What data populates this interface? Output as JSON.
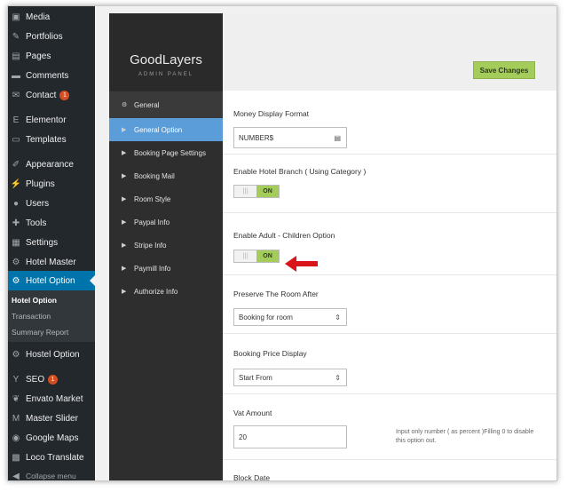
{
  "wp_sidebar": {
    "items": [
      {
        "label": "Media",
        "icon": "media-icon"
      },
      {
        "label": "Portfolios",
        "icon": "pin-icon"
      },
      {
        "label": "Pages",
        "icon": "page-icon"
      },
      {
        "label": "Comments",
        "icon": "comment-icon"
      },
      {
        "label": "Contact",
        "icon": "mail-icon",
        "badge": "1"
      },
      {
        "label": "Elementor",
        "icon": "elementor-icon"
      },
      {
        "label": "Templates",
        "icon": "folder-icon"
      },
      {
        "label": "Appearance",
        "icon": "brush-icon"
      },
      {
        "label": "Plugins",
        "icon": "plug-icon"
      },
      {
        "label": "Users",
        "icon": "user-icon"
      },
      {
        "label": "Tools",
        "icon": "wrench-icon"
      },
      {
        "label": "Settings",
        "icon": "settings-icon"
      },
      {
        "label": "Hotel Master",
        "icon": "gear-icon"
      },
      {
        "label": "Hotel Option",
        "icon": "gear-icon"
      },
      {
        "label": "Hostel Option",
        "icon": "gear-icon"
      },
      {
        "label": "SEO",
        "icon": "yoast-icon",
        "badge": "1"
      },
      {
        "label": "Envato Market",
        "icon": "envato-icon"
      },
      {
        "label": "Master Slider",
        "icon": "slider-icon"
      },
      {
        "label": "Google Maps",
        "icon": "globe-icon"
      },
      {
        "label": "Loco Translate",
        "icon": "loco-icon"
      },
      {
        "label": "Collapse menu",
        "icon": "collapse-icon"
      }
    ],
    "submenu": [
      "Hotel Option",
      "Transaction",
      "Summary Report"
    ]
  },
  "panel": {
    "brand": "GoodLayers",
    "subtitle": "ADMIN PANEL",
    "save_label": "Save Changes",
    "menu": [
      {
        "label": "General",
        "icon": "gear-icon"
      },
      {
        "label": "General Option",
        "icon": "chevron-right-icon"
      },
      {
        "label": "Booking Page Settings",
        "icon": "chevron-right-icon"
      },
      {
        "label": "Booking Mail",
        "icon": "chevron-right-icon"
      },
      {
        "label": "Room Style",
        "icon": "chevron-right-icon"
      },
      {
        "label": "Paypal Info",
        "icon": "chevron-right-icon"
      },
      {
        "label": "Stripe Info",
        "icon": "chevron-right-icon"
      },
      {
        "label": "Paymill Info",
        "icon": "chevron-right-icon"
      },
      {
        "label": "Authorize Info",
        "icon": "chevron-right-icon"
      }
    ]
  },
  "settings": {
    "money_format": {
      "label": "Money Display Format",
      "value": "NUMBER$"
    },
    "hotel_branch": {
      "label": "Enable Hotel Branch ( Using Category )",
      "state": "ON"
    },
    "adult_children": {
      "label": "Enable Adult - Children Option",
      "state": "ON"
    },
    "preserve_room": {
      "label": "Preserve The Room After",
      "value": "Booking for room"
    },
    "price_display": {
      "label": "Booking Price Display",
      "value": "Start From"
    },
    "vat": {
      "label": "Vat Amount",
      "value": "20",
      "hint": "Input only number ( as percent )Filling 0 to disable this option out."
    },
    "block_date": {
      "label": "Block Date"
    }
  },
  "colors": {
    "wp_active": "#0073aa",
    "panel_selected": "#5b9dd9",
    "toggle_on": "#a4cc5b",
    "arrow": "#d9141a"
  }
}
